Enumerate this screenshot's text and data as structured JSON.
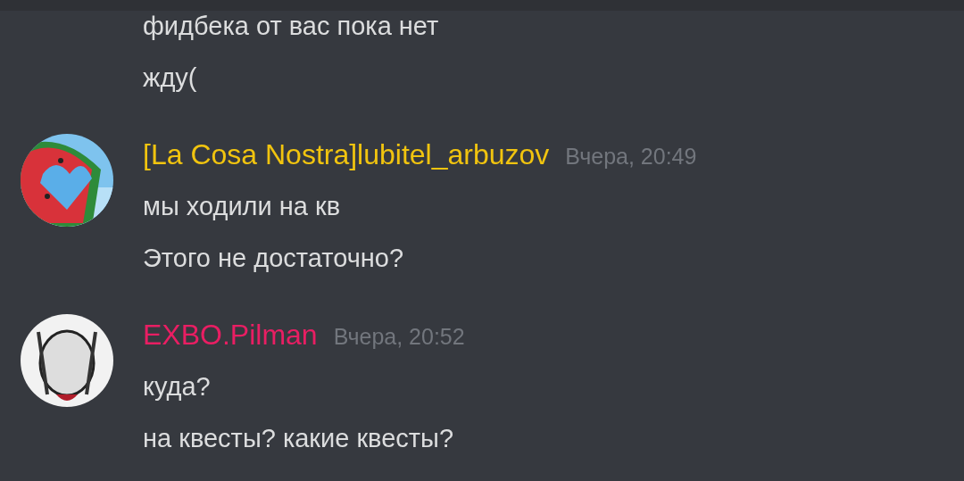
{
  "messages_before": [
    "фидбека от вас пока нет",
    "жду("
  ],
  "groups": [
    {
      "author": "[La Cosa Nostra]lubitel_arbuzov",
      "color": "#f1c40f",
      "time": "Вчера, 20:49",
      "lines": [
        "мы ходили на кв",
        "Этого не достаточно?"
      ]
    },
    {
      "avatar": {
        "kind": "figure"
      },
      "author": "EXBO.Pilman",
      "color": "#e91e63",
      "time": "Вчера, 20:52",
      "lines": [
        "куда?",
        "на квесты? какие квесты?"
      ]
    }
  ]
}
